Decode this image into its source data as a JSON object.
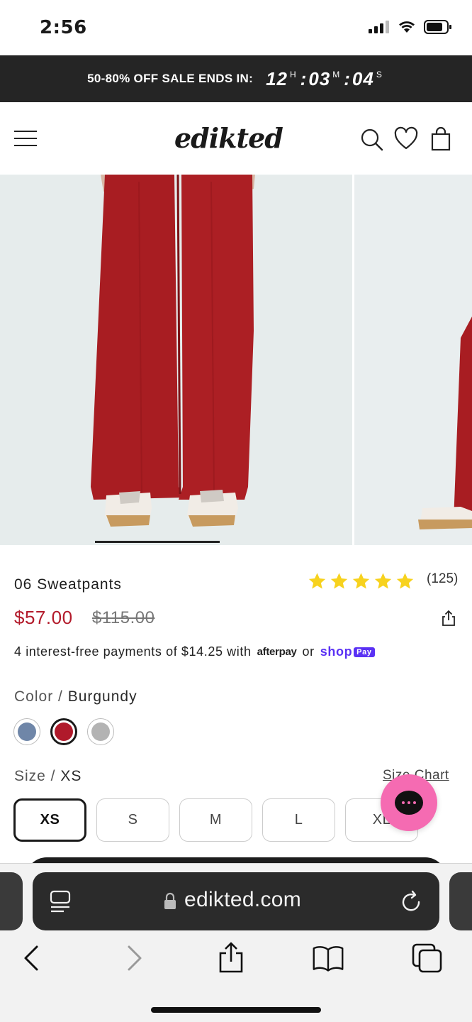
{
  "status_bar": {
    "time": "2:56"
  },
  "promo": {
    "text": "50-80% OFF SALE ENDS IN:",
    "hours": "12",
    "hours_unit": "H",
    "minutes": "03",
    "minutes_unit": "M",
    "seconds": "04",
    "seconds_unit": "S"
  },
  "header": {
    "logo": "edikted"
  },
  "product": {
    "title": "06 Sweatpants",
    "rating": 5,
    "review_count": "(125)",
    "price_sale": "$57.00",
    "price_original": "$115.00",
    "payments_text": "4 interest-free payments of $14.25 with",
    "afterpay_label": "afterpay",
    "or_text": "or",
    "shoppay_label": "shop",
    "shoppay_badge": "Pay",
    "color_label": "Color /",
    "color_value": "Burgundy",
    "colors": [
      {
        "name": "blue",
        "hex": "#6f86a8",
        "selected": false
      },
      {
        "name": "burgundy",
        "hex": "#b01a2b",
        "selected": true
      },
      {
        "name": "grey",
        "hex": "#b3b3b3",
        "selected": false
      }
    ],
    "size_label": "Size /",
    "size_value": "XS",
    "size_chart": "Size Chart",
    "sizes": [
      "XS",
      "S",
      "M",
      "L",
      "XL"
    ],
    "selected_size": "XS"
  },
  "browser": {
    "url": "edikted.com"
  },
  "colors": {
    "sale_red": "#b31b2b",
    "chat_pink": "#f56bb2",
    "star_yellow": "#f7d21e",
    "pant_red": "#a81d22"
  }
}
